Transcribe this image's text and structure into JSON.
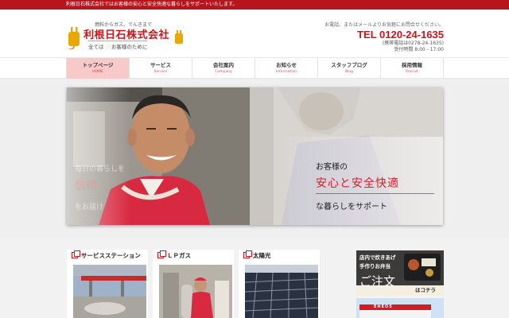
{
  "topbar": {
    "text": "利根日石株式会社ではお客様の安心と安全快適な暮らしをサポートいたします。"
  },
  "logo": {
    "tagline": "燃料からガス、でんきまで",
    "name": "利根日石株式会社",
    "sub_left": "全ては",
    "sub_right": "お客様のために"
  },
  "contact": {
    "note": "お電話、またはメールよりお気軽にお問合せください。",
    "tel": "TEL 0120-24-1635",
    "mobile": "(携帯電話は0278-24-1635)",
    "hours": "受付時間 8:00 - 17:00"
  },
  "nav": {
    "items": [
      {
        "label": "トップページ",
        "sub": "HOME"
      },
      {
        "label": "サービス",
        "sub": "Service"
      },
      {
        "label": "会社案内",
        "sub": "Company"
      },
      {
        "label": "お知らせ",
        "sub": "Information"
      },
      {
        "label": "スタッフブログ",
        "sub": "Blog"
      },
      {
        "label": "採用情報",
        "sub": "Recruit"
      }
    ],
    "active_index": 0
  },
  "hero": {
    "ghost1": "毎日の暮らしを",
    "ghost2": "信頼、",
    "ghost3": "をお届け",
    "copy1": "お客様の",
    "copy2": "安心と安全快適",
    "copy3": "な暮らしをサポート"
  },
  "cards": [
    {
      "title": "サービスステーション"
    },
    {
      "title": "ＬＰガス"
    },
    {
      "title": "太陽光"
    }
  ],
  "banner": {
    "line1": "店内で炊きあげ",
    "line2": "手作りお弁当",
    "order": "ご注文",
    "here": "はコチラ",
    "sign": "ENEOS"
  },
  "colors": {
    "brand_red": "#c8161d",
    "nav_active": "#f7c9c9"
  }
}
